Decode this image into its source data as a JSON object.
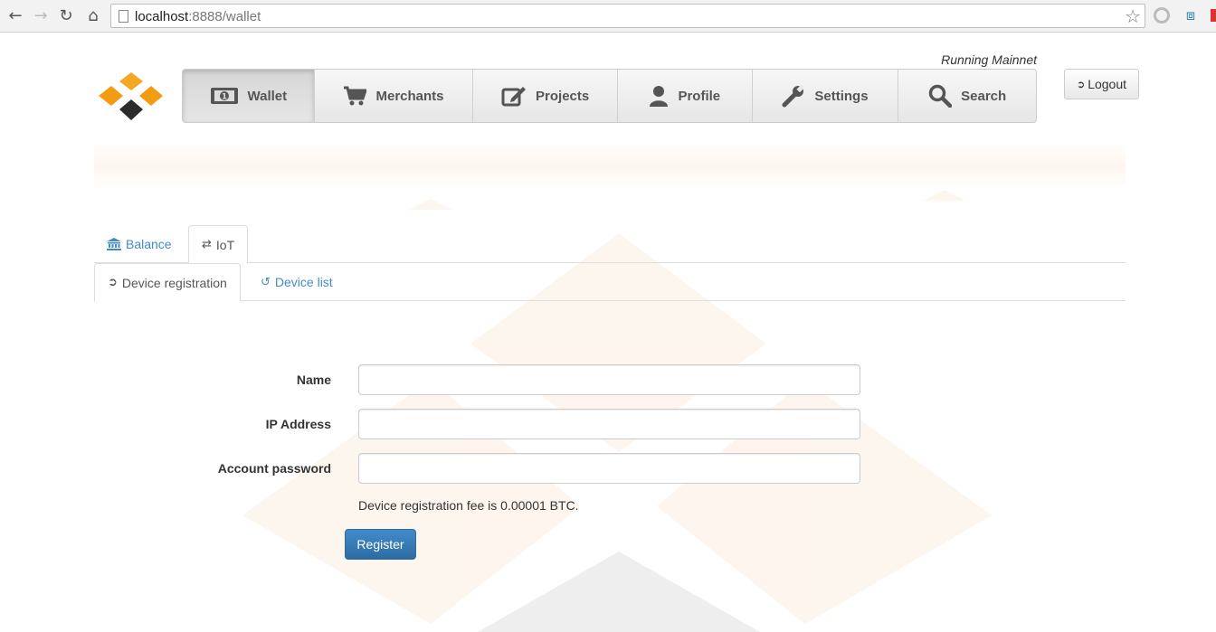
{
  "browser": {
    "url_host": "localhost",
    "url_rest": ":8888/wallet"
  },
  "header": {
    "network_status": "Running Mainnet",
    "logout_label": "Logout"
  },
  "nav": {
    "items": [
      {
        "label": "Wallet",
        "icon": "money-icon",
        "active": true
      },
      {
        "label": "Merchants",
        "icon": "cart-icon"
      },
      {
        "label": "Projects",
        "icon": "edit-icon"
      },
      {
        "label": "Profile",
        "icon": "user-icon"
      },
      {
        "label": "Settings",
        "icon": "wrench-icon"
      },
      {
        "label": "Search",
        "icon": "search-icon"
      }
    ]
  },
  "tabs": {
    "primary": [
      {
        "label": "Balance",
        "icon": "bank-icon"
      },
      {
        "label": "IoT",
        "icon": "transfer-icon",
        "active": true
      }
    ],
    "secondary": [
      {
        "label": "Device registration",
        "icon": "login-icon",
        "active": true
      },
      {
        "label": "Device list",
        "icon": "history-icon"
      }
    ]
  },
  "form": {
    "name_label": "Name",
    "name_value": "",
    "ip_label": "IP Address",
    "ip_value": "",
    "password_label": "Account password",
    "password_value": "",
    "fee_text": "Device registration fee is 0.00001 BTC.",
    "register_label": "Register"
  },
  "colors": {
    "link": "#428bca",
    "primary_button": "#2d6ca2",
    "logo_orange": "#f39c12",
    "logo_dark": "#2b2b2b"
  }
}
